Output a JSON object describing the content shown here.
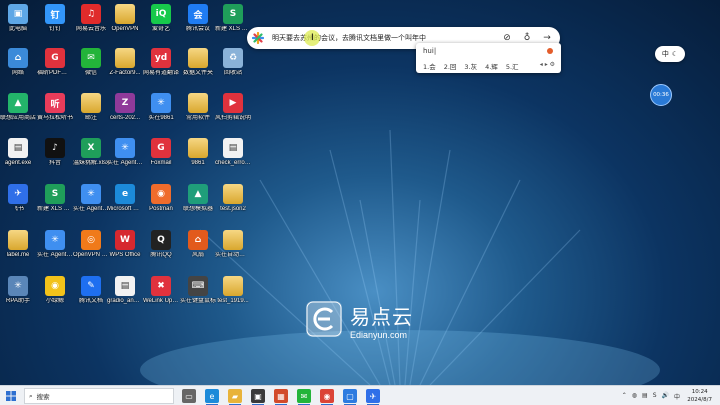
{
  "desktop": {
    "icons": [
      {
        "label": "此电脑",
        "glyph": "▣",
        "color": "#5ea7e6"
      },
      {
        "label": "钉钉",
        "glyph": "钉",
        "color": "#3296fa"
      },
      {
        "label": "网易云音乐",
        "glyph": "♫",
        "color": "#e02b2b"
      },
      {
        "label": "OpenVPN",
        "glyph": "",
        "color": "folder"
      },
      {
        "label": "爱奇艺",
        "glyph": "iQ",
        "color": "#17c94b"
      },
      {
        "label": "腾讯会议",
        "glyph": "会",
        "color": "#1f7cf2"
      },
      {
        "label": "新建 XLS 工作表.xlsx",
        "glyph": "S",
        "color": "#1f9e5a"
      },
      {
        "label": "网络",
        "glyph": "⌂",
        "color": "#3b8ad9"
      },
      {
        "label": "福昕PDF编辑器",
        "glyph": "G",
        "color": "#e0323d"
      },
      {
        "label": "微信",
        "glyph": "✉",
        "color": "#23b43a"
      },
      {
        "label": "Z-Factor9...",
        "glyph": "",
        "color": "folder"
      },
      {
        "label": "网易有道翻译",
        "glyph": "yd",
        "color": "#e0323d"
      },
      {
        "label": "数据文件夹",
        "glyph": "",
        "color": "folder"
      },
      {
        "label": "回收站",
        "glyph": "♻",
        "color": "#8ab2d8"
      },
      {
        "label": "联想应用商店",
        "glyph": "▲",
        "color": "#23b46a"
      },
      {
        "label": "黄马拉松听书",
        "glyph": "听",
        "color": "#e83c5a"
      },
      {
        "label": "邮注",
        "glyph": "",
        "color": "folder"
      },
      {
        "label": "certs-202...",
        "glyph": "Z",
        "color": "#8f3a9a"
      },
      {
        "label": "实在9861",
        "glyph": "✳",
        "color": "#3f8ff0"
      },
      {
        "label": "常用软件",
        "glyph": "",
        "color": "folder"
      },
      {
        "label": "风扫剪辑说明",
        "glyph": "▶",
        "color": "#e0323d"
      },
      {
        "label": "agent.exe",
        "glyph": "▤",
        "color": "file"
      },
      {
        "label": "抖音",
        "glyph": "♪",
        "color": "#111111"
      },
      {
        "label": "温妹挑解.xlsx",
        "glyph": "X",
        "color": "#1f9e5a"
      },
      {
        "label": "实在 Agent9606",
        "glyph": "✳",
        "color": "#3f8ff0"
      },
      {
        "label": "Foxmail",
        "glyph": "G",
        "color": "#e0323d"
      },
      {
        "label": "9861",
        "glyph": "",
        "color": "folder"
      },
      {
        "label": "check_error...",
        "glyph": "▤",
        "color": "file"
      },
      {
        "label": "飞书",
        "glyph": "✈",
        "color": "#2f6fe8"
      },
      {
        "label": "新建 XLS 工作表.xlsx",
        "glyph": "S",
        "color": "#1f9e5a"
      },
      {
        "label": "实在 Agent9897",
        "glyph": "✳",
        "color": "#3f8ff0"
      },
      {
        "label": "Microsoft Edge",
        "glyph": "e",
        "color": "#1c8ad9"
      },
      {
        "label": "Postman",
        "glyph": "◉",
        "color": "#ef6c2c"
      },
      {
        "label": "联想模拟器",
        "glyph": "▲",
        "color": "#1f9e7a"
      },
      {
        "label": "test.json2",
        "glyph": "",
        "color": "folder"
      },
      {
        "label": "label.me",
        "glyph": "",
        "color": "folder"
      },
      {
        "label": "实在 Agent10105",
        "glyph": "✳",
        "color": "#3f8ff0"
      },
      {
        "label": "OpenVPN GUI",
        "glyph": "◎",
        "color": "#f07a1a"
      },
      {
        "label": "WPS Office",
        "glyph": "W",
        "color": "#d6282f"
      },
      {
        "label": "腾讯QQ",
        "glyph": "Q",
        "color": "#222222"
      },
      {
        "label": "风扇",
        "glyph": "⌂",
        "color": "#e25a1c"
      },
      {
        "label": "实在自动化程序",
        "glyph": "",
        "color": "folder"
      },
      {
        "label": "RPA助手",
        "glyph": "✳",
        "color": "#5a86b8"
      },
      {
        "label": "小绿鲸",
        "glyph": "◉",
        "color": "#f2c21a"
      },
      {
        "label": "腾讯文档",
        "glyph": "✎",
        "color": "#1e6ff0"
      },
      {
        "label": "gradio_anno...",
        "glyph": "▤",
        "color": "file"
      },
      {
        "label": "WeLink Update 9",
        "glyph": "✖",
        "color": "#e0323d"
      },
      {
        "label": "实在键盘鼠标",
        "glyph": "⌨",
        "color": "#444444"
      },
      {
        "label": "test_1919...",
        "glyph": "",
        "color": "folder"
      }
    ]
  },
  "search": {
    "query": "明天要去苏州的会议，去腾讯文档里做一个叫年中",
    "attach_icon": "paperclip-icon",
    "mic_icon": "microphone-icon",
    "submit_icon": "arrow-right-icon"
  },
  "ime": {
    "composition": "hui|",
    "candidates": [
      "1.会",
      "2.回",
      "3.灰",
      "4.辉",
      "5.汇"
    ],
    "nav": "◂ ▸ ⚙"
  },
  "lang_indicator": {
    "label": "中",
    "mode": "☾"
  },
  "timer_badge": {
    "text": "00:36"
  },
  "watermark": {
    "cn": "易点云",
    "en": "Edianyun.com"
  },
  "taskbar": {
    "search_placeholder": "搜索",
    "apps": [
      {
        "name": "task-view",
        "glyph": "▭",
        "color": "#666666"
      },
      {
        "name": "edge",
        "glyph": "e",
        "color": "#1c8ad9"
      },
      {
        "name": "file-explorer",
        "glyph": "▰",
        "color": "#e8b33a"
      },
      {
        "name": "store",
        "glyph": "▣",
        "color": "#3a3a3a"
      },
      {
        "name": "app-red",
        "glyph": "▦",
        "color": "#d24a2a"
      },
      {
        "name": "wechat",
        "glyph": "✉",
        "color": "#23b43a"
      },
      {
        "name": "chrome",
        "glyph": "◉",
        "color": "#db4437"
      },
      {
        "name": "app-blue",
        "glyph": "▢",
        "color": "#2d7be0"
      },
      {
        "name": "feishu",
        "glyph": "✈",
        "color": "#2f6fe8"
      }
    ],
    "tray": [
      "⌃",
      "◍",
      "▤",
      "S",
      "🔊",
      "中"
    ],
    "time": "10:24",
    "date": "2024/8/7"
  }
}
